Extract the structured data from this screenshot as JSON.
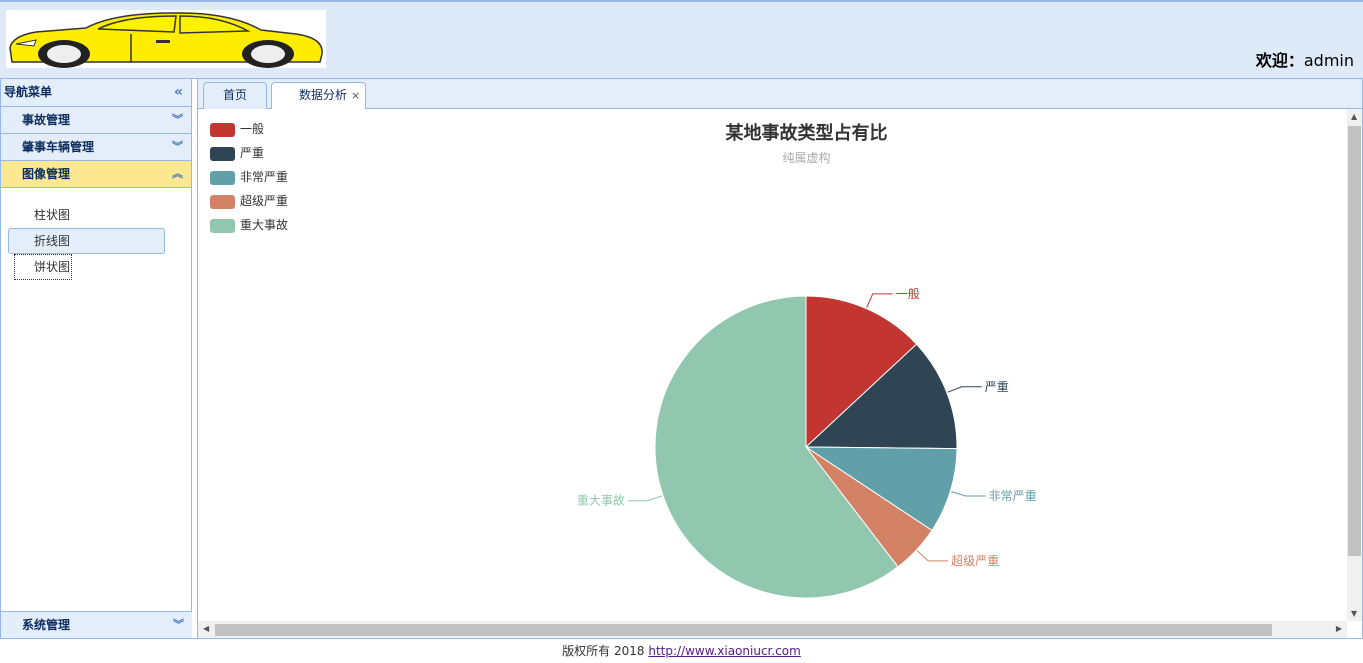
{
  "header": {
    "welcome_label": "欢迎：",
    "user": "admin"
  },
  "nav": {
    "title": "导航菜单",
    "groups": [
      {
        "label": "事故管理"
      },
      {
        "label": "肇事车辆管理"
      },
      {
        "label": "图像管理"
      }
    ],
    "sub_items": [
      "柱状图",
      "折线图",
      "饼状图"
    ],
    "bottom_group": "系统管理"
  },
  "tabs": [
    {
      "label": "首页"
    },
    {
      "label": "数据分析"
    }
  ],
  "colors": {
    "accent": "#95b8e7",
    "header_bg": "#dfeaf9",
    "active_group": "#fbe890"
  },
  "chart_data": {
    "type": "pie",
    "title": "某地事故类型占有比",
    "subtitle": "纯属虚构",
    "legend_position": "top-left",
    "slices": [
      {
        "name": "一般",
        "value": 335,
        "color": "#c23531"
      },
      {
        "name": "严重",
        "value": 310,
        "color": "#2f4554"
      },
      {
        "name": "非常严重",
        "value": 234,
        "color": "#61a0a8"
      },
      {
        "name": "超级严重",
        "value": 135,
        "color": "#d48265"
      },
      {
        "name": "重大事故",
        "value": 1548,
        "color": "#91c7ae"
      }
    ]
  },
  "footer": {
    "text": "版权所有 2018 ",
    "link": "http://www.xiaoniucr.com"
  }
}
